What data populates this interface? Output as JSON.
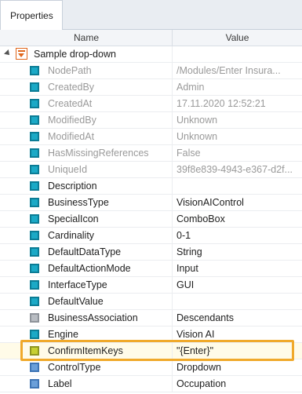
{
  "tab": {
    "label": "Properties"
  },
  "columns": {
    "name": "Name",
    "value": "Value"
  },
  "root": {
    "label": "Sample drop-down",
    "icon": "dropdown-control-icon"
  },
  "rows": [
    {
      "name": "NodePath",
      "value": "/Modules/Enter Insura...",
      "muted": true,
      "icon": "property-icon"
    },
    {
      "name": "CreatedBy",
      "value": "Admin",
      "muted": true,
      "icon": "property-icon"
    },
    {
      "name": "CreatedAt",
      "value": "17.11.2020 12:52:21",
      "muted": true,
      "icon": "property-icon"
    },
    {
      "name": "ModifiedBy",
      "value": "Unknown",
      "muted": true,
      "icon": "property-icon"
    },
    {
      "name": "ModifiedAt",
      "value": "Unknown",
      "muted": true,
      "icon": "property-icon"
    },
    {
      "name": "HasMissingReferences",
      "value": "False",
      "muted": true,
      "icon": "property-icon"
    },
    {
      "name": "UniqueId",
      "value": "39f8e839-4943-e367-d2f...",
      "muted": true,
      "icon": "property-icon"
    },
    {
      "name": "Description",
      "value": "",
      "muted": false,
      "icon": "property-icon"
    },
    {
      "name": "BusinessType",
      "value": "VisionAIControl",
      "muted": false,
      "icon": "property-icon"
    },
    {
      "name": "SpecialIcon",
      "value": "ComboBox",
      "muted": false,
      "icon": "property-icon"
    },
    {
      "name": "Cardinality",
      "value": "0-1",
      "muted": false,
      "icon": "property-icon"
    },
    {
      "name": "DefaultDataType",
      "value": "String",
      "muted": false,
      "icon": "property-icon"
    },
    {
      "name": "DefaultActionMode",
      "value": "Input",
      "muted": false,
      "icon": "property-icon"
    },
    {
      "name": "InterfaceType",
      "value": "GUI",
      "muted": false,
      "icon": "property-icon"
    },
    {
      "name": "DefaultValue",
      "value": "",
      "muted": false,
      "icon": "property-icon"
    },
    {
      "name": "BusinessAssociation",
      "value": "Descendants",
      "muted": false,
      "icon": "association-icon"
    },
    {
      "name": "Engine",
      "value": "Vision AI",
      "muted": false,
      "icon": "property-icon"
    },
    {
      "name": "ConfirmItemKeys",
      "value": "\"{Enter}\"",
      "muted": false,
      "icon": "highlighted-property-icon"
    },
    {
      "name": "ControlType",
      "value": "Dropdown",
      "muted": false,
      "icon": "blue-property-icon"
    },
    {
      "name": "Label",
      "value": "Occupation",
      "muted": false,
      "icon": "blue-property-icon"
    }
  ],
  "colors": {
    "accent_highlight": "#f0a92a",
    "property_teal": "#1ba9c6"
  }
}
